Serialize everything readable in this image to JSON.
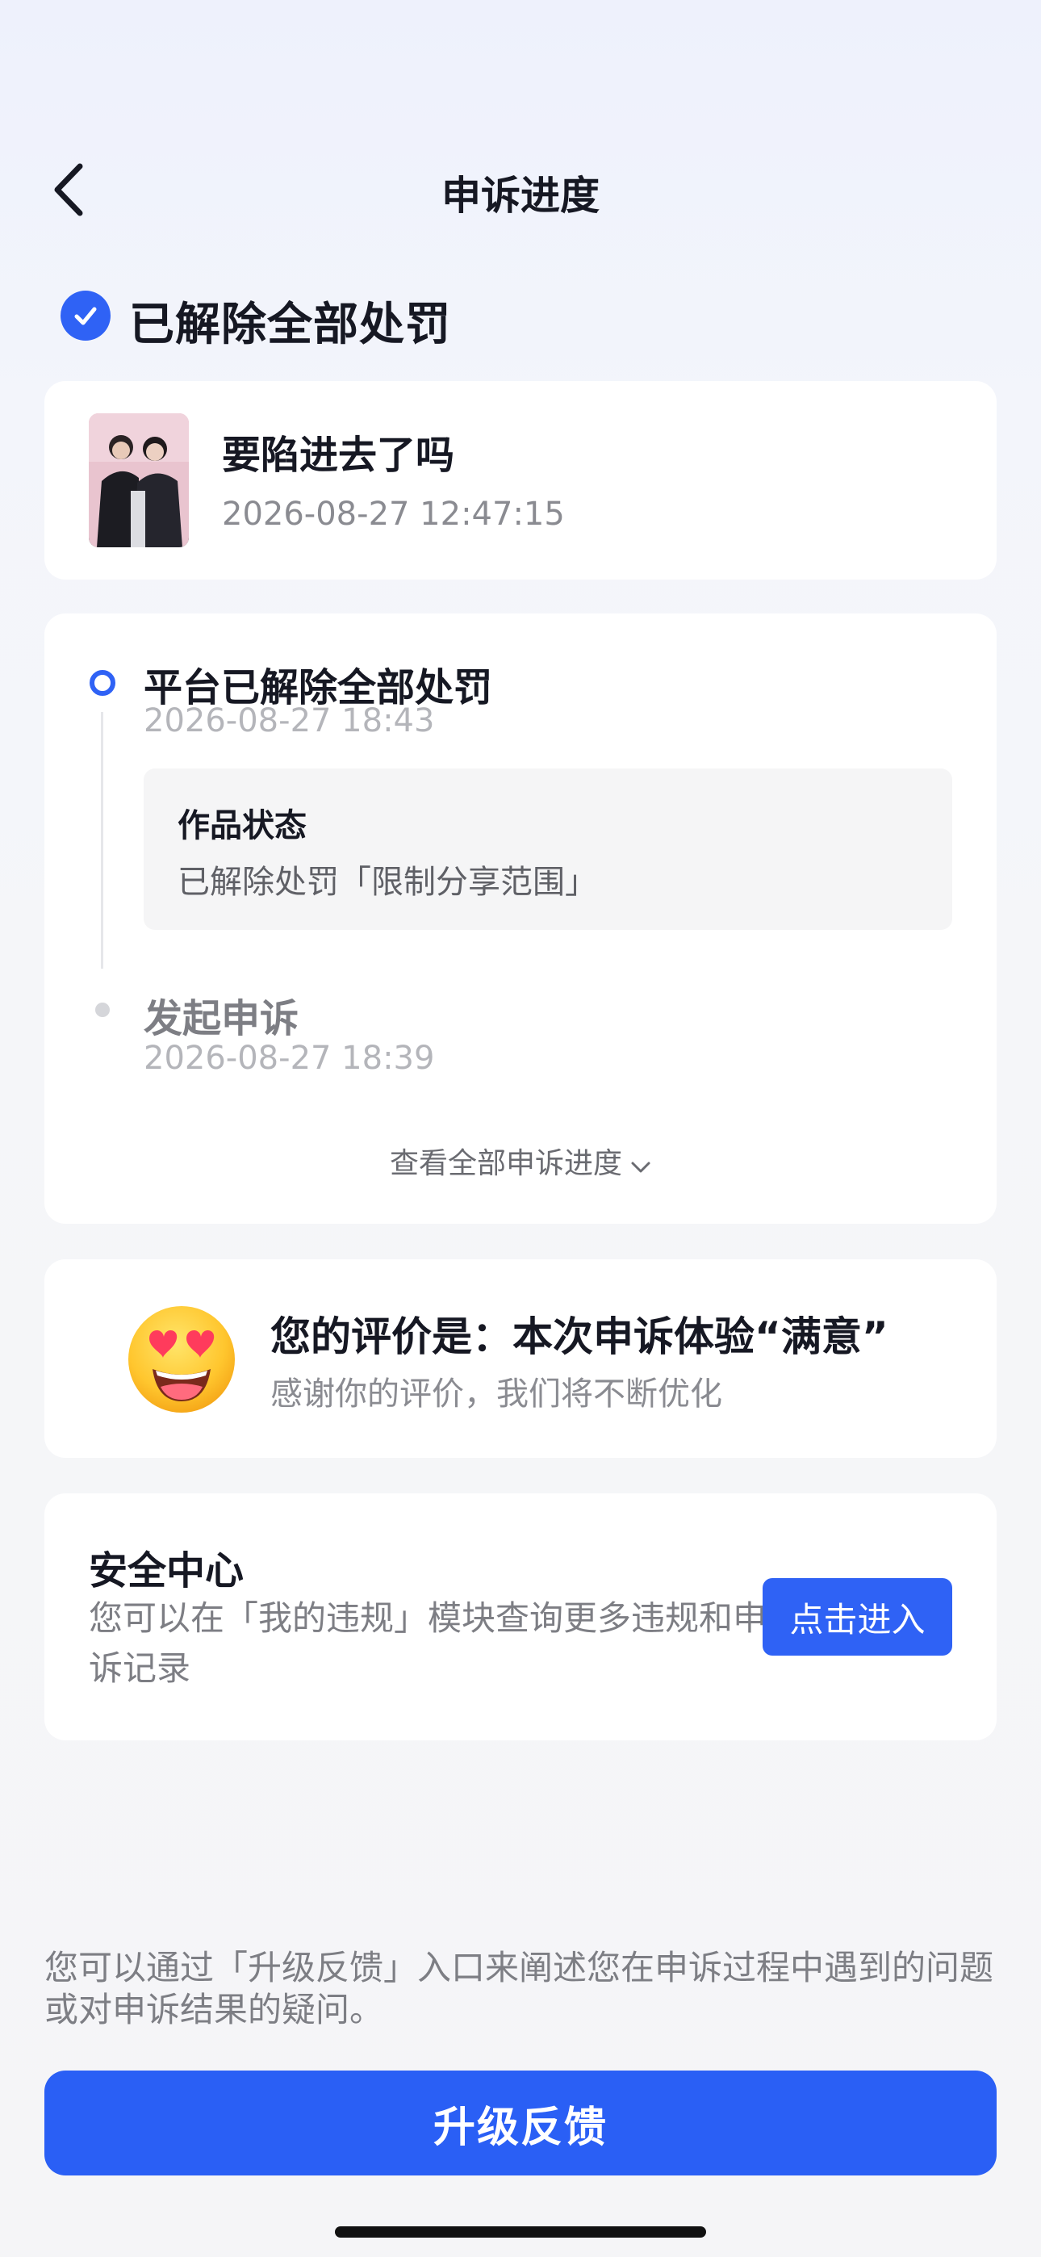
{
  "nav": {
    "title": "申诉进度",
    "back_icon": "chevron-left-icon"
  },
  "status": {
    "icon": "check-circle-icon",
    "text": "已解除全部处罚",
    "color": "#2f62f5"
  },
  "work": {
    "title": "要陷进去了吗",
    "time": "2026-08-27 12:47:15"
  },
  "progress": {
    "steps": [
      {
        "title": "平台已解除全部处罚",
        "time": "2026-08-27 18:43",
        "detail_title": "作品状态",
        "detail_text": "已解除处罚「限制分享范围」"
      },
      {
        "title": "发起申诉",
        "time": "2026-08-27 18:39"
      }
    ],
    "view_all_label": "查看全部申诉进度"
  },
  "rating": {
    "icon": "heart-eyes-emoji-icon",
    "title": "您的评价是：本次申诉体验“满意”",
    "subtitle": "感谢你的评价，我们将不断优化"
  },
  "security": {
    "title": "安全中心",
    "description": "您可以在「我的违规」模块查询更多违规和申诉记录",
    "button_label": "点击进入"
  },
  "footer": {
    "note": "您可以通过「升级反馈」入口来阐述您在申诉过程中遇到的问题或对申诉结果的疑问。",
    "button_label": "升级反馈"
  },
  "colors": {
    "accent": "#2f62f5",
    "text_primary": "#161823",
    "text_secondary": "#8a8b91"
  }
}
